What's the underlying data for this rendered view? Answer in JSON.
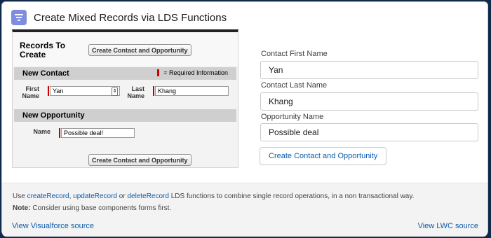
{
  "header": {
    "title": "Create Mixed Records via LDS Functions",
    "icon": "filter-list-icon",
    "icon_color": "#7f8de1"
  },
  "visualforce": {
    "title": "Records To Create",
    "top_button": "Create Contact and Opportunity",
    "bottom_button": "Create Contact and Opportunity",
    "new_contact": {
      "section_title": "New Contact",
      "required_legend": "= Required Information",
      "first_name_label": "First Name",
      "first_name_value": "Yan",
      "last_name_label": "Last Name",
      "last_name_value": "Khang"
    },
    "new_opportunity": {
      "section_title": "New Opportunity",
      "name_label": "Name",
      "name_value": "Possible deal!"
    },
    "required_color": "#cc0000"
  },
  "lwc": {
    "contact_first_name_label": "Contact First Name",
    "contact_first_name_value": "Yan",
    "contact_last_name_label": "Contact Last Name",
    "contact_last_name_value": "Khang",
    "opportunity_name_label": "Opportunity Name",
    "opportunity_name_value": "Possible deal",
    "button": "Create Contact and Opportunity"
  },
  "footer": {
    "use": "Use",
    "create_record": "createRecord",
    "comma": ",",
    "update_record": "updateRecord",
    "or": "or",
    "delete_record": "deleteRecord",
    "description": "LDS functions to combine single record operations, in a non transactional way.",
    "note_label": "Note:",
    "note_text": "Consider using base components forms first.",
    "vf_link": "View Visualforce source",
    "lwc_link": "View LWC source"
  },
  "colors": {
    "link": "#0b5cab",
    "background": "#0f2a4a"
  }
}
